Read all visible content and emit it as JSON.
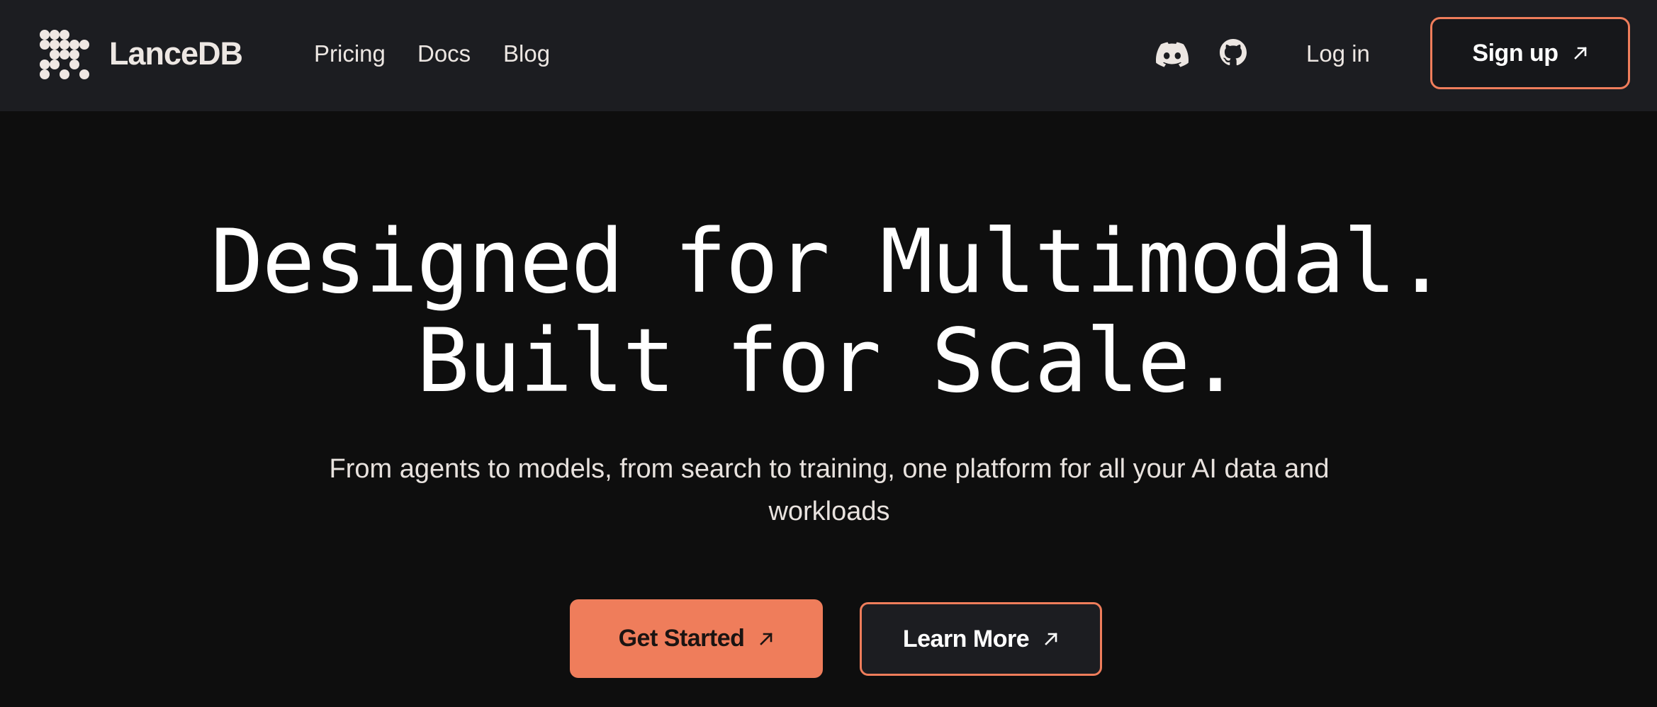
{
  "header": {
    "brand": "LanceDB",
    "logo_icon": "lancedb-logo-icon",
    "nav": [
      {
        "label": "Pricing"
      },
      {
        "label": "Docs"
      },
      {
        "label": "Blog"
      }
    ],
    "icons": [
      "discord-icon",
      "github-icon"
    ],
    "login_label": "Log in",
    "signup_label": "Sign up",
    "signup_icon": "arrow-up-right-icon"
  },
  "hero": {
    "title_line1": "Designed for Multimodal.",
    "title_line2": "Built for Scale.",
    "subtitle": "From agents to models, from search to training, one platform for all your AI data and workloads",
    "primary_cta": "Get Started",
    "secondary_cta": "Learn More",
    "cta_icon": "arrow-up-right-icon"
  },
  "colors": {
    "background": "#0e0e0e",
    "navbar": "#1c1d21",
    "accent": "#ef7d5b",
    "text": "#ffffff"
  }
}
